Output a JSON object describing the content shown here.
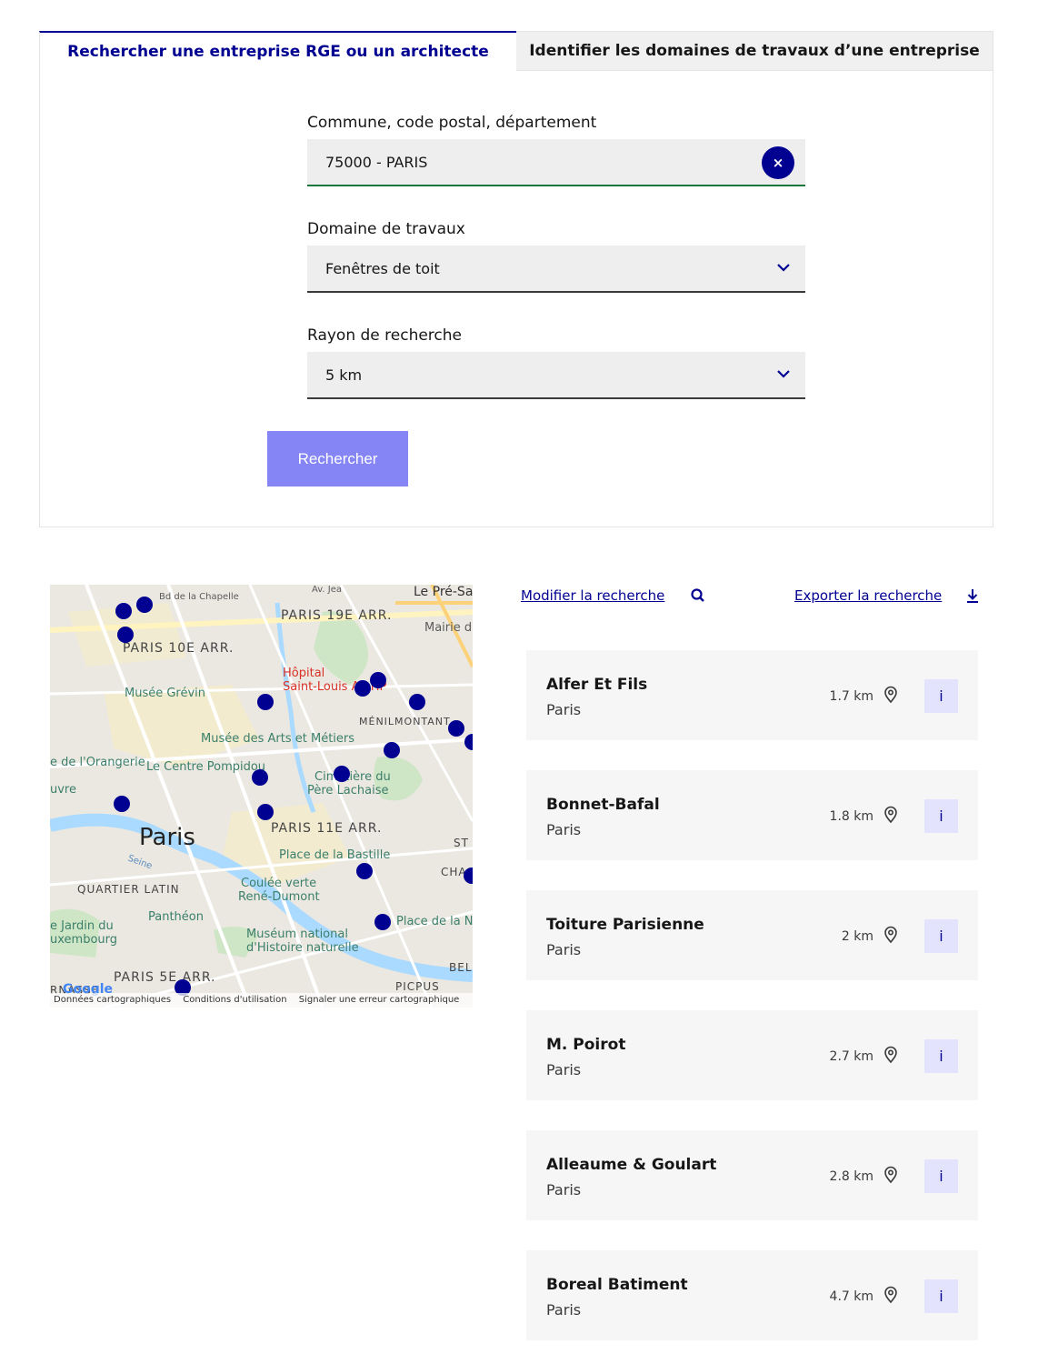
{
  "tabs": {
    "active": "Rechercher une entreprise RGE ou un architecte",
    "inactive": "Identifier les domaines de travaux d’une entreprise"
  },
  "form": {
    "commune_label": "Commune, code postal, département",
    "commune_value": "75000 - PARIS",
    "clear_symbol": "×",
    "domaine_label": "Domaine de travaux",
    "domaine_value": "Fenêtres de toit",
    "rayon_label": "Rayon de recherche",
    "rayon_value": "5 km",
    "submit_label": "Rechercher"
  },
  "map": {
    "labels": {
      "bd_chapelle": "Bd de la Chapelle",
      "av_jean": "Av. Jea",
      "le_pre": "Le Pré-Sa",
      "paris19": "PARIS 19E ARR.",
      "mairie": "Mairie d",
      "paris10": "PARIS 10E ARR.",
      "hopital": "Hôpital",
      "saint_louis": "Saint-Louis AP-HP",
      "musee_grevin": "Musée Grévin",
      "menilmontant": "MÉNILMONTANT",
      "arts_metiers": "Musée des Arts et Métiers",
      "orangerie": "e de l'Orangerie",
      "pompidou": "Le Centre Pompidou",
      "cimetiere": "Cimetière du",
      "pere_lachaise": "Père Lachaise",
      "louvre": "uvre",
      "paris": "Paris",
      "paris11": "PARIS 11E ARR.",
      "st": "ST",
      "bastille": "Place de la Bastille",
      "cha": "CHA",
      "seine": "Seine",
      "quartier_latin": "QUARTIER LATIN",
      "coulee": "Coulée verte",
      "rene_dumont": "René-Dumont",
      "pantheon": "Panthéon",
      "place_de_la": "Place de la N",
      "jardin": "e Jardin du",
      "luxembourg": "uxembourg",
      "museum": "Muséum national",
      "histoire": "d'Histoire naturelle",
      "bel": "BEL",
      "paris5": "PARIS 5E ARR.",
      "picpus": "PICPUS",
      "google": "Google",
      "rasse": "RNASSE"
    },
    "footer": {
      "data": "Données cartographiques",
      "terms": "Conditions d'utilisation",
      "report": "Signaler une erreur cartographique"
    },
    "pin_color": "#000091"
  },
  "results": {
    "modify_label": "Modifier la recherche",
    "export_label": "Exporter la recherche",
    "info_label": "i",
    "items": [
      {
        "name": "Alfer Et Fils",
        "city": "Paris",
        "distance": "1.7 km"
      },
      {
        "name": "Bonnet-Bafal",
        "city": "Paris",
        "distance": "1.8 km"
      },
      {
        "name": "Toiture Parisienne",
        "city": "Paris",
        "distance": "2 km"
      },
      {
        "name": "M. Poirot",
        "city": "Paris",
        "distance": "2.7 km"
      },
      {
        "name": "Alleaume & Goulart",
        "city": "Paris",
        "distance": "2.8 km"
      },
      {
        "name": "Boreal Batiment",
        "city": "Paris",
        "distance": "4.7 km"
      }
    ]
  },
  "colors": {
    "primary": "#000091",
    "button_disabled": "#8585f6",
    "valid": "#18753c",
    "card_bg": "#f6f6f6",
    "info_bg": "#e3e3fd"
  }
}
